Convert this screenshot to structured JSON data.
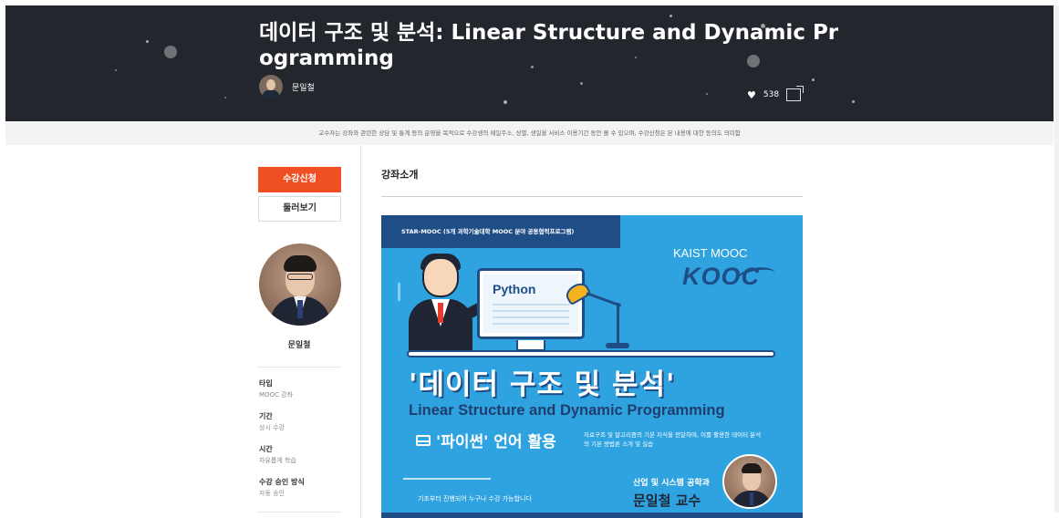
{
  "course": {
    "title": "데이터 구조 및 분석: Linear Structure and Dynamic Programming",
    "author": "문일철",
    "likes": "538"
  },
  "notice": "교수자는 강좌와 관련한 상담 및 통계 등의 운영을 목적으로 수강생의 메일주소, 성별, 생일을 서비스 이용기간 동안 볼 수 있으며, 수강신청은 본 내용에 대한 동의도 의미함",
  "sidebar": {
    "enroll_label": "수강신청",
    "preview_label": "둘러보기",
    "professor_name": "문일철",
    "info": [
      {
        "key": "타입",
        "value": "MOOC 강좌"
      },
      {
        "key": "기간",
        "value": "상시 수강"
      },
      {
        "key": "시간",
        "value": "자유롭게 학습"
      },
      {
        "key": "수강 승인 방식",
        "value": "자동 승인"
      }
    ]
  },
  "main": {
    "section_title": "강좌소개"
  },
  "banner": {
    "top_label": "STAR-MOOC (5개 과학기술대학 MOOC 분야 공동협력프로그램)",
    "kaist": "KAIST MOOC",
    "kooc": "KOOC",
    "python": "Python",
    "title_ko": "'데이터 구조 및 분석'",
    "title_en": "Linear Structure and Dynamic Programming",
    "python_use": "'파이썬' 언어 활용",
    "desc": "자료구조 및 알고리즘의 기본 지식을 전달하며, 이를 활용한 데이터 분석의 기본 방법론 소개 및 실습",
    "bottom_note": "기초부터 진행되어 누구나 수강 가능합니다",
    "dept": "산업 및 시스템 공학과",
    "professor": "문일철 교수"
  },
  "colors": {
    "header_bg": "#23262d",
    "accent": "#f04e23",
    "banner_blue": "#2fa3e0",
    "navy": "#1f4d86"
  }
}
